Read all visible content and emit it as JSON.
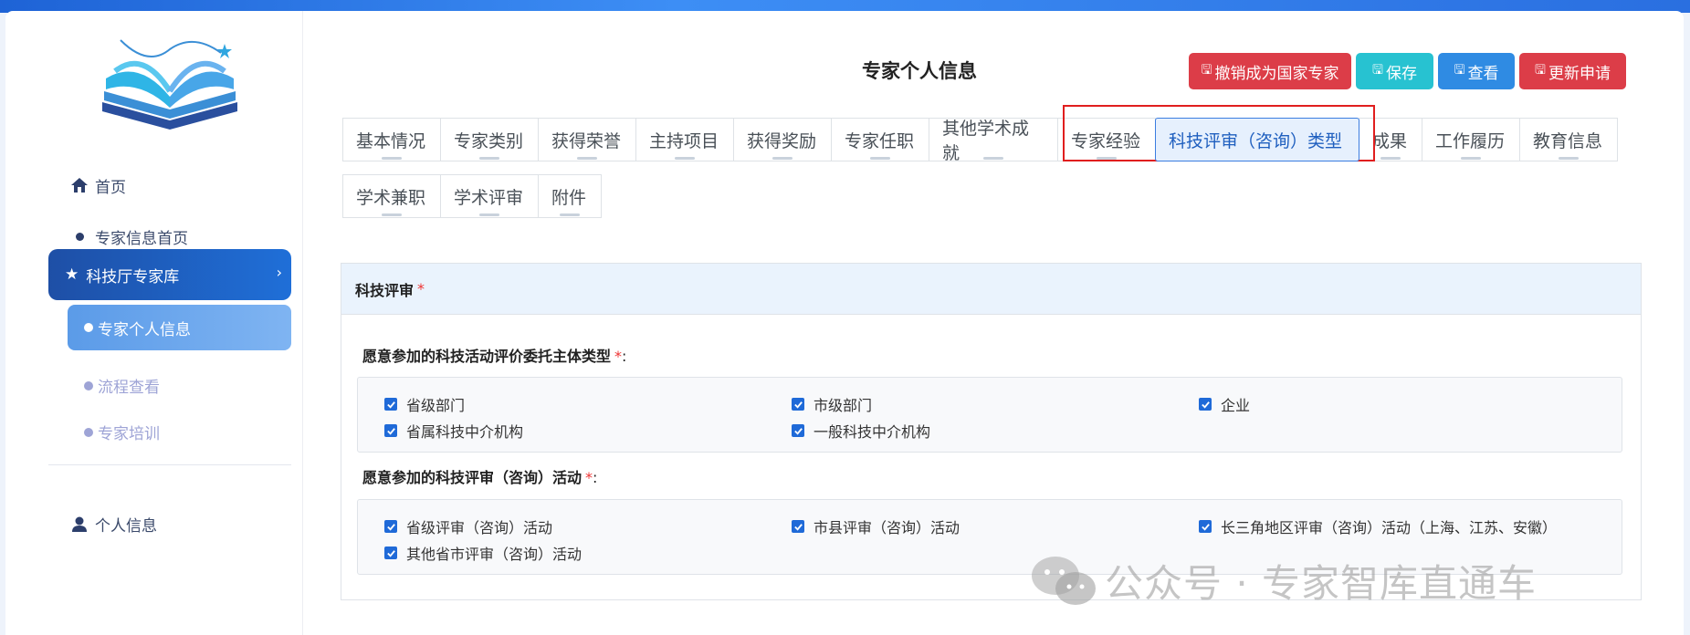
{
  "sidebar": {
    "home": "首页",
    "expert_home": "专家信息首页",
    "active_group": "科技厅专家库",
    "sub_items": [
      "专家个人信息",
      "流程查看",
      "专家培训"
    ],
    "personal_info": "个人信息"
  },
  "header": {
    "title": "专家个人信息",
    "buttons": {
      "revoke": "撤销成为国家专家",
      "save": "保存",
      "view": "查看",
      "update": "更新申请"
    }
  },
  "tabs_row1": [
    "基本情况",
    "专家类别",
    "获得荣誉",
    "主持项目",
    "获得奖励",
    "专家任职",
    "其他学术成就",
    "专家经验",
    "科技评审（咨询）类型",
    "成果",
    "工作履历",
    "教育信息"
  ],
  "tabs_row2": [
    "学术兼职",
    "学术评审",
    "附件"
  ],
  "active_tab": "科技评审（咨询）类型",
  "panel": {
    "title": "科技评审",
    "required_mark": "*",
    "q1": {
      "label": "愿意参加的科技活动评价委托主体类型",
      "options": [
        "省级部门",
        "市级部门",
        "企业",
        "省属科技中介机构",
        "一般科技中介机构"
      ],
      "checked": [
        true,
        true,
        true,
        true,
        true
      ]
    },
    "q2": {
      "label": "愿意参加的科技评审（咨询）活动",
      "options": [
        "省级评审（咨询）活动",
        "市县评审（咨询）活动",
        "长三角地区评审（咨询）活动（上海、江苏、安徽）",
        "其他省市评审（咨询）活动"
      ],
      "checked": [
        true,
        true,
        true,
        true
      ]
    }
  },
  "colon": ":",
  "watermark": "公众号 · 专家智库直通车",
  "colors": {
    "primary": "#1f6ad8",
    "danger": "#dc3d48",
    "teal": "#27c2d1",
    "highlight": "#e01e1e"
  }
}
